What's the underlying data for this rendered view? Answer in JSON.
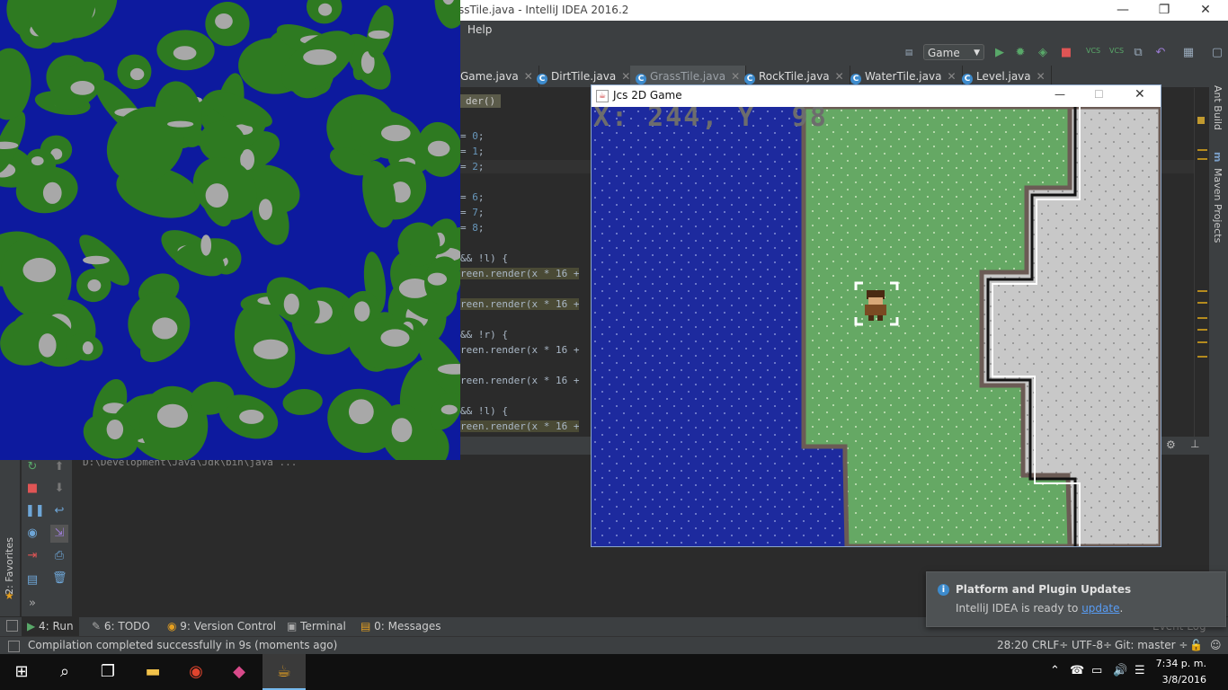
{
  "ide": {
    "window_title": "ssTile.java - IntelliJ IDEA 2016.2",
    "menu_help": "Help",
    "run_config": "Game",
    "vcs1": "VCS",
    "vcs2": "VCS",
    "tabs": [
      {
        "label": "Game.java",
        "active": false
      },
      {
        "label": "DirtTile.java",
        "active": false
      },
      {
        "label": "GrassTile.java",
        "active": true
      },
      {
        "label": "RockTile.java",
        "active": false
      },
      {
        "label": "WaterTile.java",
        "active": false
      },
      {
        "label": "Level.java",
        "active": false
      }
    ],
    "breadcrumb": "der()",
    "code_lines": [
      {
        "pre": "= ",
        "num": "0",
        "post": ";"
      },
      {
        "pre": "= ",
        "num": "1",
        "post": ";"
      },
      {
        "pre": "= ",
        "num": "2",
        "post": ";"
      },
      {
        "pre": "= ",
        "num": "6",
        "post": ";"
      },
      {
        "pre": "= ",
        "num": "7",
        "post": ";"
      },
      {
        "pre": "= ",
        "num": "8",
        "post": ";"
      },
      {
        "text": "&& !l) {"
      },
      {
        "text": "reen.render(x * 16 +"
      },
      {
        "text": "reen.render(x * 16 +"
      },
      {
        "text": "&& !r) {"
      },
      {
        "text": "reen.render(x * 16 +"
      },
      {
        "text": "reen.render(x * 16 +"
      },
      {
        "text": "&& !l) {"
      },
      {
        "text": "reen.render(x * 16 +"
      }
    ],
    "right_strip": {
      "ant": "Ant Build",
      "maven": "Maven Projects"
    },
    "favorites": "2: Favorites",
    "console_text": "D:\\Development\\Java\\Jdk\\bin\\java ...",
    "toolwindows": [
      {
        "label": "4: Run",
        "active": true
      },
      {
        "label": "6: TODO",
        "active": false
      },
      {
        "label": "9: Version Control",
        "active": false
      },
      {
        "label": "Terminal",
        "active": false
      },
      {
        "label": "0: Messages",
        "active": false
      }
    ],
    "event_log": "Event Log",
    "status": {
      "message": "Compilation completed successfully in 9s (moments ago)",
      "position": "28:20",
      "line_sep": "CRLF÷",
      "encoding": "UTF-8÷",
      "git": "Git: master ÷"
    }
  },
  "notification": {
    "title": "Platform and Plugin Updates",
    "body_prefix": "IntelliJ IDEA is ready to ",
    "link": "update",
    "body_suffix": "."
  },
  "game": {
    "window_title": "Jcs 2D Game",
    "coords": "X: 244, Y  98",
    "colors": {
      "water": "#1d2a9e",
      "grass": "#65a864",
      "rock": "#c8c8c8",
      "edge": "#6b5b55"
    }
  },
  "map": {
    "colors": {
      "water": "#0d1a9e",
      "grass": "#2e7a21",
      "rock": "#a8a8a8"
    }
  },
  "taskbar": {
    "time": "7:34 p. m.",
    "date": "3/8/2016"
  }
}
